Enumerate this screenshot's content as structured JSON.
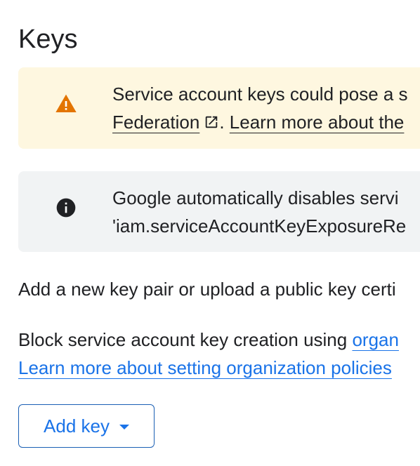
{
  "page": {
    "title": "Keys"
  },
  "warning_banner": {
    "icon": "warning-icon",
    "icon_color": "#e37400",
    "line1": "Service account keys could pose a s",
    "federation_link": "Federation",
    "separator": ".",
    "learn_more_link": "Learn more about the"
  },
  "info_banner": {
    "icon": "info-icon",
    "line1": "Google automatically disables servi",
    "line2": "'iam.serviceAccountKeyExposureRe"
  },
  "body": {
    "add_new_key_text": "Add a new key pair or upload a public key certi",
    "block_text": "Block service account key creation using ",
    "org_link": "organ",
    "learn_org_policies_link": "Learn more about setting organization policies"
  },
  "actions": {
    "add_key_label": "Add key",
    "add_key_icon": "arrow-drop-down-icon"
  },
  "colors": {
    "warning_bg": "#fef7e0",
    "info_bg": "#f1f3f4",
    "link_blue": "#1a73e8"
  }
}
